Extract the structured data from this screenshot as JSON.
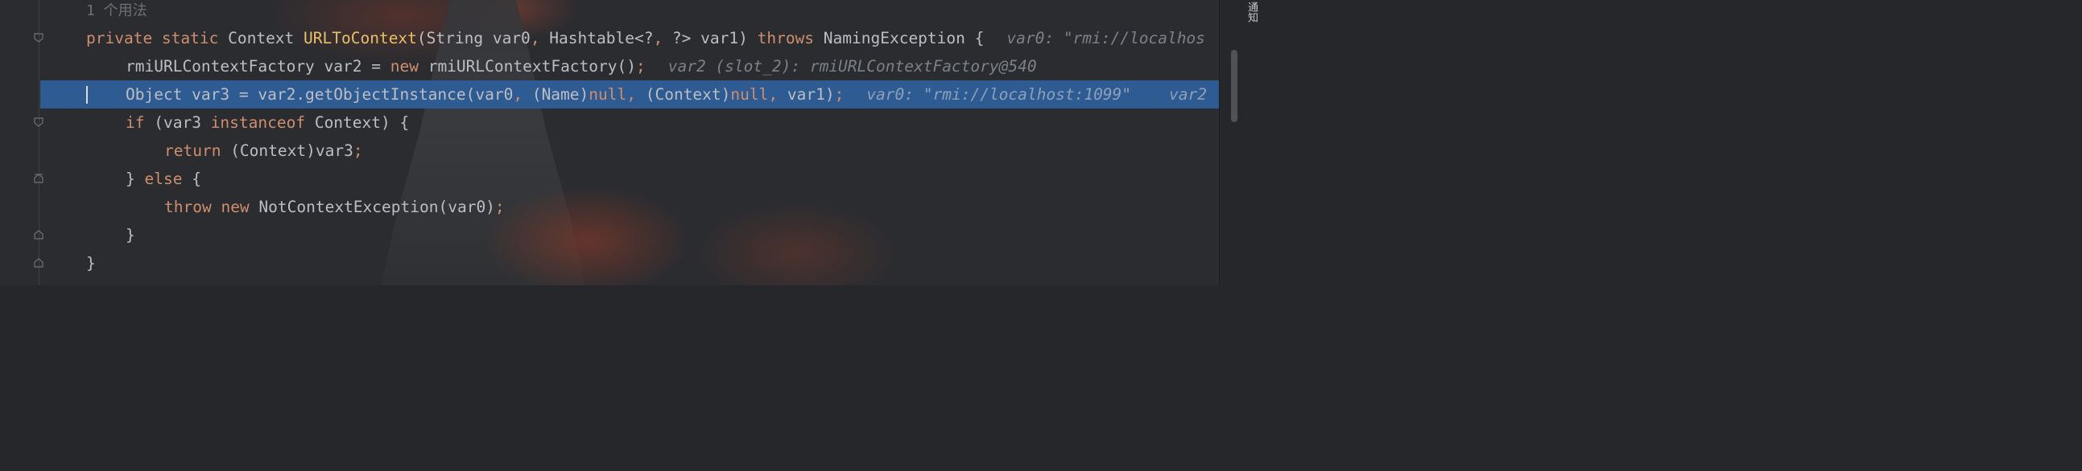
{
  "editor": {
    "usage_hint": "1 个用法",
    "lines": [
      {
        "tokens": [
          {
            "t": "private ",
            "c": "kw"
          },
          {
            "t": "static ",
            "c": "kw"
          },
          {
            "t": "Context ",
            "c": "txt"
          },
          {
            "t": "URLToContext",
            "c": "fn"
          },
          {
            "t": "(String var0",
            "c": "txt"
          },
          {
            "t": ", ",
            "c": "sep"
          },
          {
            "t": "Hashtable<?",
            "c": "txt"
          },
          {
            "t": ", ",
            "c": "sep"
          },
          {
            "t": "?> var1) ",
            "c": "txt"
          },
          {
            "t": "throws ",
            "c": "kw"
          },
          {
            "t": "NamingException {",
            "c": "txt"
          }
        ],
        "inlay": "var0: \"rmi://localhos"
      },
      {
        "tokens": [
          {
            "t": "rmiURLContextFactory var2 = ",
            "c": "txt"
          },
          {
            "t": "new ",
            "c": "kw"
          },
          {
            "t": "rmiURLContextFactory()",
            "c": "txt"
          },
          {
            "t": ";",
            "c": "sep"
          }
        ],
        "inlay": "var2 (slot_2): rmiURLContextFactory@540"
      },
      {
        "tokens": [
          {
            "t": "Object var3 = var2.getObjectInstance(var0",
            "c": "txt"
          },
          {
            "t": ", ",
            "c": "sep"
          },
          {
            "t": "(Name)",
            "c": "txt"
          },
          {
            "t": "null",
            "c": "kw"
          },
          {
            "t": ", ",
            "c": "sep"
          },
          {
            "t": "(Context)",
            "c": "txt"
          },
          {
            "t": "null",
            "c": "kw"
          },
          {
            "t": ", ",
            "c": "sep"
          },
          {
            "t": "var1)",
            "c": "txt"
          },
          {
            "t": ";",
            "c": "sep"
          }
        ],
        "inlay": "var0: \"rmi://localhost:1099\"    var2"
      },
      {
        "tokens": [
          {
            "t": "if ",
            "c": "kw"
          },
          {
            "t": "(var3 ",
            "c": "txt"
          },
          {
            "t": "instanceof ",
            "c": "kw"
          },
          {
            "t": "Context) {",
            "c": "txt"
          }
        ],
        "inlay": ""
      },
      {
        "tokens": [
          {
            "t": "return ",
            "c": "kw"
          },
          {
            "t": "(Context)var3",
            "c": "txt"
          },
          {
            "t": ";",
            "c": "sep"
          }
        ],
        "inlay": ""
      },
      {
        "tokens": [
          {
            "t": "} ",
            "c": "txt"
          },
          {
            "t": "else ",
            "c": "kw"
          },
          {
            "t": "{",
            "c": "txt"
          }
        ],
        "inlay": ""
      },
      {
        "tokens": [
          {
            "t": "throw ",
            "c": "kw"
          },
          {
            "t": "new ",
            "c": "kw"
          },
          {
            "t": "NotContextException(var0)",
            "c": "txt"
          },
          {
            "t": ";",
            "c": "sep"
          }
        ],
        "inlay": ""
      },
      {
        "tokens": [
          {
            "t": "}",
            "c": "txt"
          }
        ],
        "inlay": ""
      },
      {
        "tokens": [
          {
            "t": "}",
            "c": "txt"
          }
        ],
        "inlay": ""
      }
    ]
  },
  "sidebar": {
    "notifications_label": "通知"
  },
  "colors": {
    "keyword": "#cf8e6d",
    "method": "#e8c06a",
    "text": "#bcbec4",
    "highlight": "#2f5b93"
  }
}
